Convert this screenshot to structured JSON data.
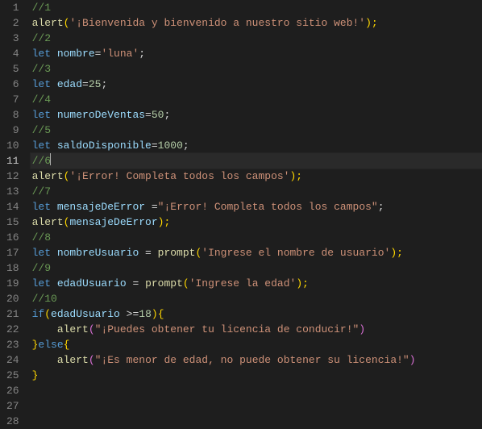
{
  "editor": {
    "active_line": 11,
    "line_count": 28,
    "lines": {
      "l1": {
        "cm": "//1"
      },
      "l2": {
        "fn": "alert",
        "p1": "(",
        "str": "'¡Bienvenida y bienvenido a nuestro sitio web!'",
        "p2": ");"
      },
      "l3": {
        "cm": "//2"
      },
      "l4": {
        "kw": "let",
        "vr": "nombre",
        "eq": "=",
        "str": "'luna'",
        "p": ";"
      },
      "l5": {
        "cm": "//3"
      },
      "l6": {
        "kw": "let",
        "vr": "edad",
        "eq": "=",
        "nm": "25",
        "p": ";"
      },
      "l7": {
        "cm": "//4"
      },
      "l8": {
        "kw": "let",
        "vr": "numeroDeVentas",
        "eq": "=",
        "nm": "50",
        "p": ";"
      },
      "l9": {
        "cm": "//5"
      },
      "l10": {
        "kw": "let",
        "vr": "saldoDisponible",
        "eq": "=",
        "nm": "1000",
        "p": ";"
      },
      "l11": {
        "cm": "//6"
      },
      "l12": {
        "fn": "alert",
        "p1": "(",
        "str": "'¡Error! Completa todos los campos'",
        "p2": ");"
      },
      "l13": {
        "cm": "//7"
      },
      "l14": {
        "kw": "let",
        "vr": "mensajeDeError",
        "sp": " ",
        "eq": "=",
        "str": "\"¡Error! Completa todos los campos\"",
        "p": ";"
      },
      "l15": {
        "fn": "alert",
        "p1": "(",
        "vr": "mensajeDeError",
        "p2": ");"
      },
      "l16": {
        "cm": "//8"
      },
      "l17": {
        "kw": "let",
        "vr": "nombreUsuario",
        "eq": " = ",
        "fn": "prompt",
        "p1": "(",
        "str": "'Ingrese el nombre de usuario'",
        "p2": ");"
      },
      "l18": {
        "cm": "//9"
      },
      "l19": {
        "kw": "let",
        "vr": "edadUsuario",
        "eq": " = ",
        "fn": "prompt",
        "p1": "(",
        "str": "'Ingrese la edad'",
        "p2": ");"
      },
      "l20": {
        "cm": "//10"
      },
      "l21": {
        "kw": "if",
        "p1": "(",
        "vr": "edadUsuario",
        "op": " >=",
        "nm": "18",
        "p2": ")",
        "br": "{"
      },
      "l22": {
        "fn": "alert",
        "p1": "(",
        "str": "\"¡Puedes obtener tu licencia de conducir!\"",
        "p2": ")"
      },
      "l23": {
        "br": "}",
        "kw": "else",
        "br2": "{"
      },
      "l24": {
        "fn": "alert",
        "p1": "(",
        "str": "\"¡Es menor de edad, no puede obtener su licencia!\"",
        "p2": ")"
      },
      "l25": {
        "br": "}"
      }
    }
  }
}
